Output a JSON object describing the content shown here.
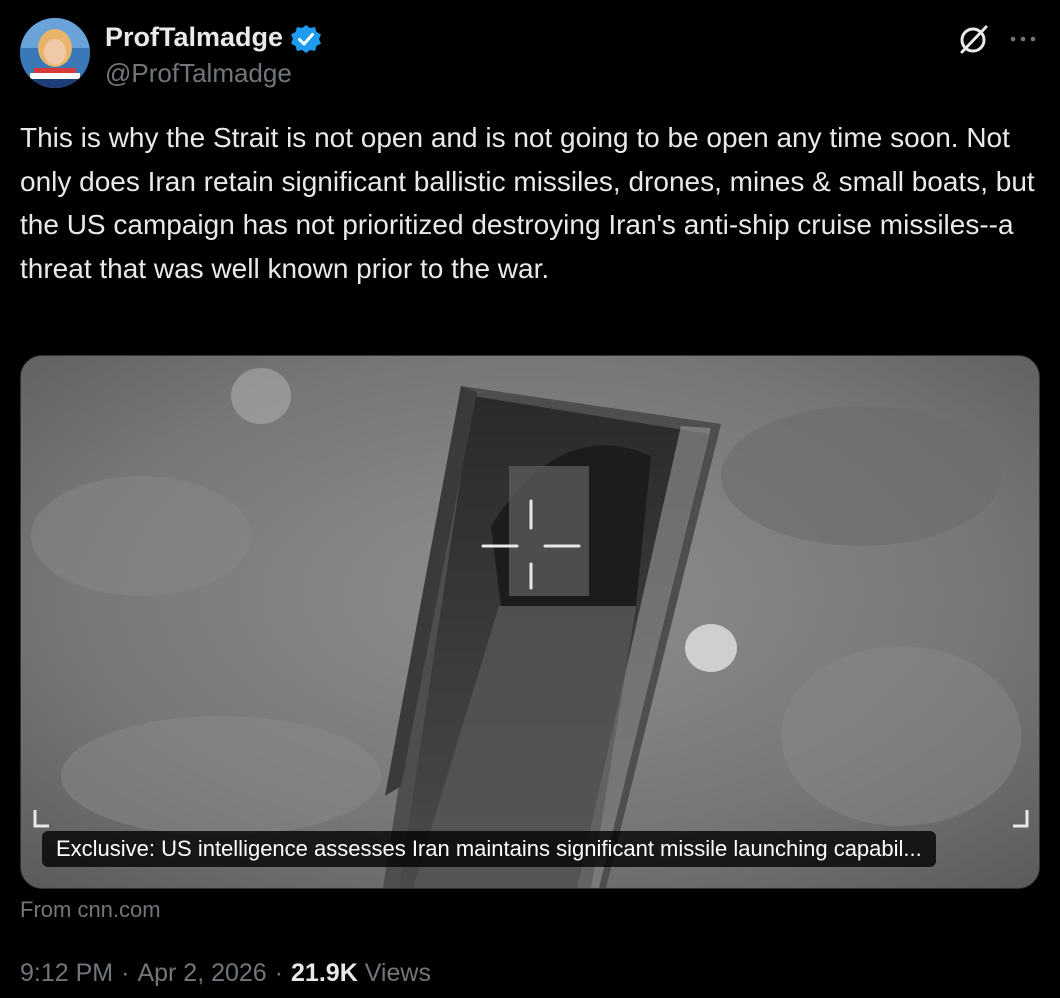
{
  "author": {
    "display_name": "ProfTalmadge",
    "handle": "@ProfTalmadge",
    "verified_color": "#1d9bf0"
  },
  "header_actions": {
    "grok_icon": "grok-icon",
    "more_icon": "more-icon"
  },
  "tweet": {
    "text": "This is why the Strait is not open and is not going to be open any time soon. Not only does Iran retain significant ballistic missiles, drones, mines & small boats, but the US campaign has not prioritized destroying Iran's anti-ship cruise missiles--a threat that was well known prior to the war."
  },
  "link_card": {
    "caption": "Exclusive: US intelligence assesses Iran maintains significant missile launching capabil...",
    "source": "From cnn.com"
  },
  "meta": {
    "time": "9:12 PM",
    "separator": "·",
    "date": "Apr 2, 2026",
    "views_count": "21.9K",
    "views_label": "Views"
  },
  "colors": {
    "background": "#000000",
    "primary_text": "#e7e9ea",
    "secondary_text": "#71767b",
    "accent": "#1d9bf0"
  }
}
